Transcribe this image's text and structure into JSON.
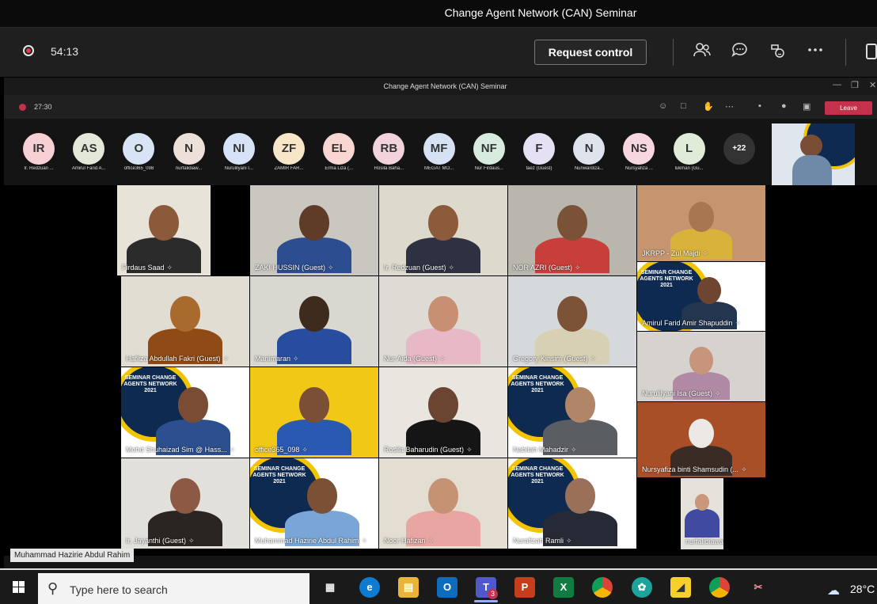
{
  "window": {
    "title": "Change Agent Network (CAN) Seminar"
  },
  "toolbar": {
    "timer": "54:13",
    "request_control": "Request control",
    "icons": [
      "people-icon",
      "chat-icon",
      "copilot-icon",
      "more-icon",
      "share-icon"
    ]
  },
  "inner_window": {
    "title": "Change Agent Network (CAN) Seminar",
    "timer": "27:30",
    "leave": "Leave"
  },
  "avatars": [
    {
      "initials": "IR",
      "name": "Ir. Redzuan ...",
      "color": "#f6d0d4"
    },
    {
      "initials": "AS",
      "name": "Amirul Farid A...",
      "color": "#e3e8d8"
    },
    {
      "initials": "O",
      "name": "office365_098",
      "color": "#d7e4f6"
    },
    {
      "initials": "N",
      "name": "nurfalidiaw...",
      "color": "#ece0d8"
    },
    {
      "initials": "NI",
      "name": "Nurulilyani I...",
      "color": "#d6e2f5"
    },
    {
      "initials": "ZF",
      "name": "ZAMIR FAR...",
      "color": "#f7e6c8"
    },
    {
      "initials": "EL",
      "name": "Erma Liza (...",
      "color": "#f8d6d2"
    },
    {
      "initials": "RB",
      "name": "Rosila Baha...",
      "color": "#f2d3db"
    },
    {
      "initials": "MF",
      "name": "MEGAT MO...",
      "color": "#d6e2f4"
    },
    {
      "initials": "NF",
      "name": "Nur Firdaus...",
      "color": "#d7ecde"
    },
    {
      "initials": "F",
      "name": "faez (Guest)",
      "color": "#e5e0f3"
    },
    {
      "initials": "N",
      "name": "Nunwardiza...",
      "color": "#dee3ec"
    },
    {
      "initials": "NS",
      "name": "Nursyafiza ...",
      "color": "#f6d7e0"
    },
    {
      "initials": "L",
      "name": "lukman (Gu...",
      "color": "#e0ecd8"
    },
    {
      "initials": "+22",
      "name": "",
      "color": "#333333"
    }
  ],
  "tiles": [
    {
      "label": "Firdaus Saad",
      "wall": "#e7e3d9",
      "skin": "#8a5a3a",
      "shirt": "#2b2b2b",
      "seminar": false
    },
    {
      "label": "ZAKI HUSSIN (Guest)",
      "wall": "#c9c7bf",
      "skin": "#5f3c28",
      "shirt": "#2c4d8f",
      "seminar": false
    },
    {
      "label": "Ir. Redzuan (Guest)",
      "wall": "#ddd9cc",
      "skin": "#8b5b3b",
      "shirt": "#2d3142",
      "seminar": false
    },
    {
      "label": "NOR AZRI (Guest)",
      "wall": "#b9b6ad",
      "skin": "#7a5238",
      "shirt": "#c83e3a",
      "seminar": false
    },
    {
      "label": "JKRPP - Zul Majdi",
      "wall": "#c59570",
      "skin": "#a9774f",
      "shirt": "#d8b23a",
      "seminar": false
    },
    {
      "label": "Hafliza Abdullah Fakri (Guest)",
      "wall": "#e2ddd3",
      "skin": "#a86b2d",
      "shirt": "#8f4a16",
      "seminar": false
    },
    {
      "label": "Manimaran",
      "wall": "#d8d8d0",
      "skin": "#3f2a1e",
      "shirt": "#294d9e",
      "seminar": false
    },
    {
      "label": "Nur Aida (Guest)",
      "wall": "#dedbd4",
      "skin": "#c98f73",
      "shirt": "#e7b9c6",
      "seminar": false
    },
    {
      "label": "Gregory Kinsim (Guest)",
      "wall": "#d6d9dc",
      "skin": "#7d5338",
      "shirt": "#d8d0b4",
      "seminar": false
    },
    {
      "label": "Amirul Farid Amir Shapuddin",
      "wall": "#ffffff",
      "skin": "#6d4531",
      "shirt": "#23354f",
      "seminar": true
    },
    {
      "label": "Nurulilyani Isa (Guest)",
      "wall": "#d6d3cf",
      "skin": "#c7957c",
      "shirt": "#b08aa5",
      "seminar": false
    },
    {
      "label": "Mohd Shuhaizad Sim @ Hass...",
      "wall": "#ffffff",
      "skin": "#7b4c34",
      "shirt": "#2c4f8e",
      "seminar": true
    },
    {
      "label": "office365_098",
      "wall": "#f2c817",
      "skin": "#7b4f35",
      "shirt": "#2a59b2",
      "seminar": false
    },
    {
      "label": "Rosila Baharudin (Guest)",
      "wall": "#e9e6df",
      "skin": "#6b4532",
      "shirt": "#151515",
      "seminar": false
    },
    {
      "label": "Nabilah Mahadzir",
      "wall": "#ffffff",
      "skin": "#b08667",
      "shirt": "#5a5e63",
      "seminar": true
    },
    {
      "label": "Nursyafiza binti Shamsudin (...",
      "wall": "#a94f28",
      "skin": "#ece8e6",
      "shirt": "#3a2b25",
      "seminar": false
    },
    {
      "label": "Ir. Jayanthi (Guest)",
      "wall": "#e2e0db",
      "skin": "#8c5a44",
      "shirt": "#2b2521",
      "seminar": false
    },
    {
      "label": "Muhammad Hazirie Abdul Rahim",
      "wall": "#ffffff",
      "skin": "#7c5035",
      "shirt": "#79a6d6",
      "seminar": true
    },
    {
      "label": "Noor Hafizan",
      "wall": "#e3ddd2",
      "skin": "#c69274",
      "shirt": "#e9a5a1",
      "seminar": false
    },
    {
      "label": "Nurafizah Ramli",
      "wall": "#ffffff",
      "skin": "#9a7058",
      "shirt": "#262a36",
      "seminar": true
    },
    {
      "label": "nurfalidiawati",
      "wall": "#e5e2dc",
      "skin": "#c9977c",
      "shirt": "#3f4aa0",
      "seminar": false
    }
  ],
  "seminar_text": "SEMINAR\nCHANGE AGENTS\nNETWORK\n2021",
  "active_speaker": "Muhammad Hazirie Abdul Rahim",
  "taskbar": {
    "search_placeholder": "Type here to search",
    "temperature": "28°C",
    "teams_badge": "3",
    "apps": [
      "task-view-icon",
      "edge-icon",
      "file-explorer-icon",
      "outlook-icon",
      "teams-icon",
      "powerpoint-icon",
      "excel-icon",
      "chrome-icon",
      "app-icon",
      "sticky-notes-icon",
      "chrome-profile-icon",
      "snip-icon"
    ]
  }
}
